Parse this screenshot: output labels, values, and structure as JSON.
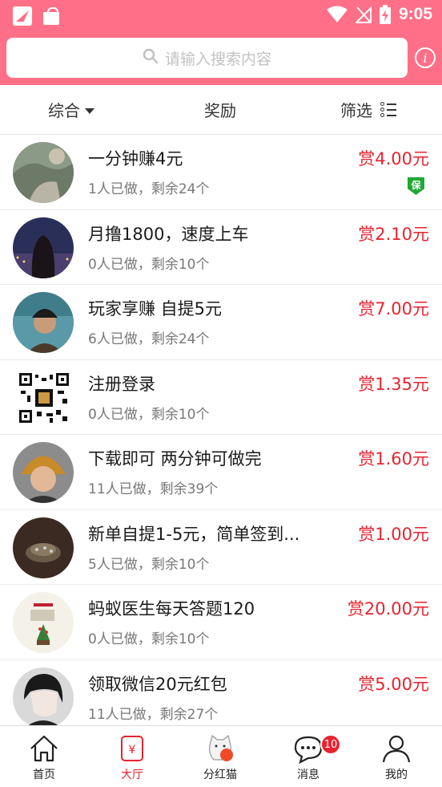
{
  "status_bar": {
    "time": "9:05"
  },
  "search": {
    "placeholder": "请输入搜索内容"
  },
  "filters": [
    {
      "label": "综合",
      "has_caret": true
    },
    {
      "label": "奖励"
    },
    {
      "label": "筛选"
    }
  ],
  "tasks": [
    {
      "title": "一分钟赚4元",
      "stats": "1人已做，剩余24个",
      "reward": "赏4.00元",
      "badge": "保",
      "avatar": "landscape-photo"
    },
    {
      "title": "月撸1800，速度上车",
      "stats": "0人已做，剩余10个",
      "reward": "赏2.10元",
      "avatar": "girl-photo"
    },
    {
      "title": "玩家享赚 自提5元",
      "stats": "6人已做，剩余24个",
      "reward": "赏7.00元",
      "avatar": "man-photo"
    },
    {
      "title": "注册登录",
      "stats": "0人已做，剩余10个",
      "reward": "赏1.35元",
      "avatar": "qr-code"
    },
    {
      "title": "下载即可 两分钟可做完",
      "stats": "11人已做，剩余39个",
      "reward": "赏1.60元",
      "avatar": "costume-photo"
    },
    {
      "title": "新单自提1-5元，简单签到...",
      "stats": "5人已做，剩余10个",
      "reward": "赏1.00元",
      "avatar": "dark-object-photo"
    },
    {
      "title": "蚂蚁医生每天答题120",
      "stats": "0人已做，剩余10个",
      "reward": "赏20.00元",
      "avatar": "poster-photo"
    },
    {
      "title": "领取微信20元红包",
      "stats": "11人已做，剩余27个",
      "reward": "赏5.00元",
      "avatar": "anime-boy"
    }
  ],
  "nav": [
    {
      "label": "首页",
      "icon": "home-icon"
    },
    {
      "label": "大厅",
      "icon": "hall-icon",
      "active": true,
      "glyph": "¥"
    },
    {
      "label": "分红猫",
      "icon": "cat-icon"
    },
    {
      "label": "消息",
      "icon": "message-icon",
      "badge": "10"
    },
    {
      "label": "我的",
      "icon": "profile-icon"
    }
  ],
  "colors": {
    "header": "#ff6f87",
    "accent_red": "#e8232f",
    "badge_green": "#21a836"
  }
}
